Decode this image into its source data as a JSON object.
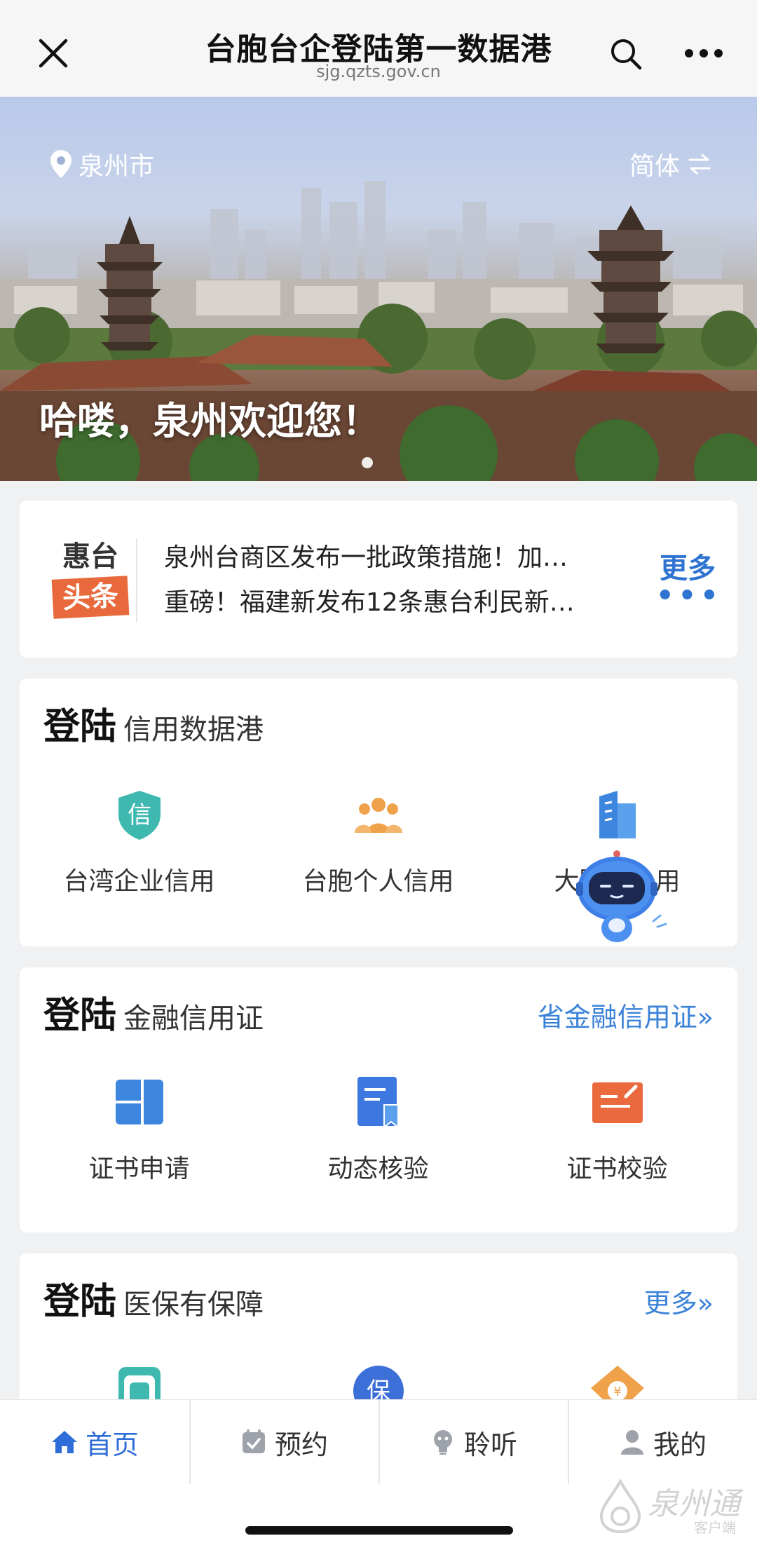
{
  "topbar": {
    "title": "台胞台企登陆第一数据港",
    "url": "sjg.qzts.gov.cn",
    "close_icon": "close-icon",
    "search_icon": "search-icon",
    "more_icon": "more-dots-icon"
  },
  "banner": {
    "location": "泉州市",
    "lang_toggle": "简体",
    "welcome": "哈喽，泉州欢迎您！"
  },
  "news": {
    "badge_top": "惠台",
    "badge_bottom": "头条",
    "items": [
      "泉州台商区发布一批政策措施！加…",
      "重磅！福建新发布12条惠台利民新…"
    ],
    "more": "更多",
    "more_dots": "•••"
  },
  "sections": [
    {
      "title_big": "登陆",
      "title_small": "信用数据港",
      "link": "",
      "items": [
        {
          "label": "台湾企业信用",
          "icon": "credit-shield-icon"
        },
        {
          "label": "台胞个人信用",
          "icon": "people-group-icon"
        },
        {
          "label": "大陆台…用",
          "icon": "building-icon"
        }
      ]
    },
    {
      "title_big": "登陆",
      "title_small": "金融信用证",
      "link": "省金融信用证»",
      "items": [
        {
          "label": "证书申请",
          "icon": "layout-grid-icon"
        },
        {
          "label": "动态核验",
          "icon": "document-bookmark-icon"
        },
        {
          "label": "证书校验",
          "icon": "certificate-edit-icon"
        }
      ]
    },
    {
      "title_big": "登陆",
      "title_small": "医保有保障",
      "link": "更多»",
      "items": [
        {
          "icon": "medical-card-icon"
        },
        {
          "icon": "insurance-badge-icon"
        },
        {
          "icon": "money-house-icon"
        }
      ]
    }
  ],
  "tabs": [
    {
      "label": "首页",
      "icon": "home-icon",
      "active": true
    },
    {
      "label": "预约",
      "icon": "calendar-check-icon",
      "active": false
    },
    {
      "label": "聆听",
      "icon": "lightbulb-icon",
      "active": false
    },
    {
      "label": "我的",
      "icon": "user-icon",
      "active": false
    }
  ],
  "watermark": {
    "name": "泉州通",
    "sub": "客户端"
  },
  "colors": {
    "accent_blue": "#2f6ed8",
    "link_blue": "#3a82d8",
    "badge_orange": "#e86a3c",
    "teal": "#3fb9b0",
    "icon_orange": "#f0a24a"
  }
}
